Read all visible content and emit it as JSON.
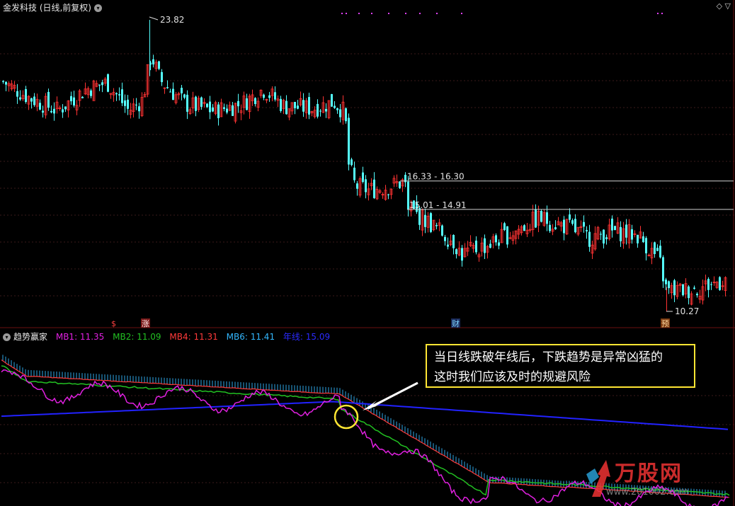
{
  "header": {
    "title": "金发科技 (日线,前复权)",
    "top_icons": "◇ ▽"
  },
  "indicator": {
    "name": "趋势赢家",
    "mb1_label": "MB1: 11.35",
    "mb2_label": "MB2: 11.09",
    "mb4_label": "MB4: 11.31",
    "mb6_label": "MB6: 11.41",
    "annual_label": "年线: 15.09",
    "colors": {
      "mb1": "#e020e0",
      "mb2": "#22c022",
      "mb4": "#ff3a3a",
      "mb6": "#33b8ff",
      "annual": "#2222ff"
    }
  },
  "callout": {
    "line1": "当日线跌破年线后，下跌趋势是异常凶猛的",
    "line2": "这时我们应该及时的规避风险"
  },
  "watermark": {
    "text": "万股网",
    "url": "www.201002.com"
  },
  "chart_data": [
    {
      "type": "candlestick",
      "title": "金发科技 (日线,前复权)",
      "annotations": [
        {
          "label": "23.82",
          "kind": "high"
        },
        {
          "label": "16.33 - 16.30",
          "kind": "price-line"
        },
        {
          "label": "15.01 - 14.91",
          "kind": "price-line"
        },
        {
          "label": "10.27",
          "kind": "low"
        }
      ],
      "event_markers": [
        "$",
        "涨",
        "财",
        "预"
      ],
      "price_levels": [
        16.33,
        15.01
      ],
      "high": 23.82,
      "low": 10.27,
      "colors": {
        "up": "#ff3333",
        "down": "#54ffff"
      }
    },
    {
      "type": "line",
      "title": "趋势赢家",
      "series": [
        {
          "name": "MB1",
          "last": 11.35
        },
        {
          "name": "MB2",
          "last": 11.09
        },
        {
          "name": "MB4",
          "last": 11.31
        },
        {
          "name": "MB6",
          "last": 11.41
        },
        {
          "name": "年线",
          "last": 15.09
        }
      ]
    }
  ]
}
